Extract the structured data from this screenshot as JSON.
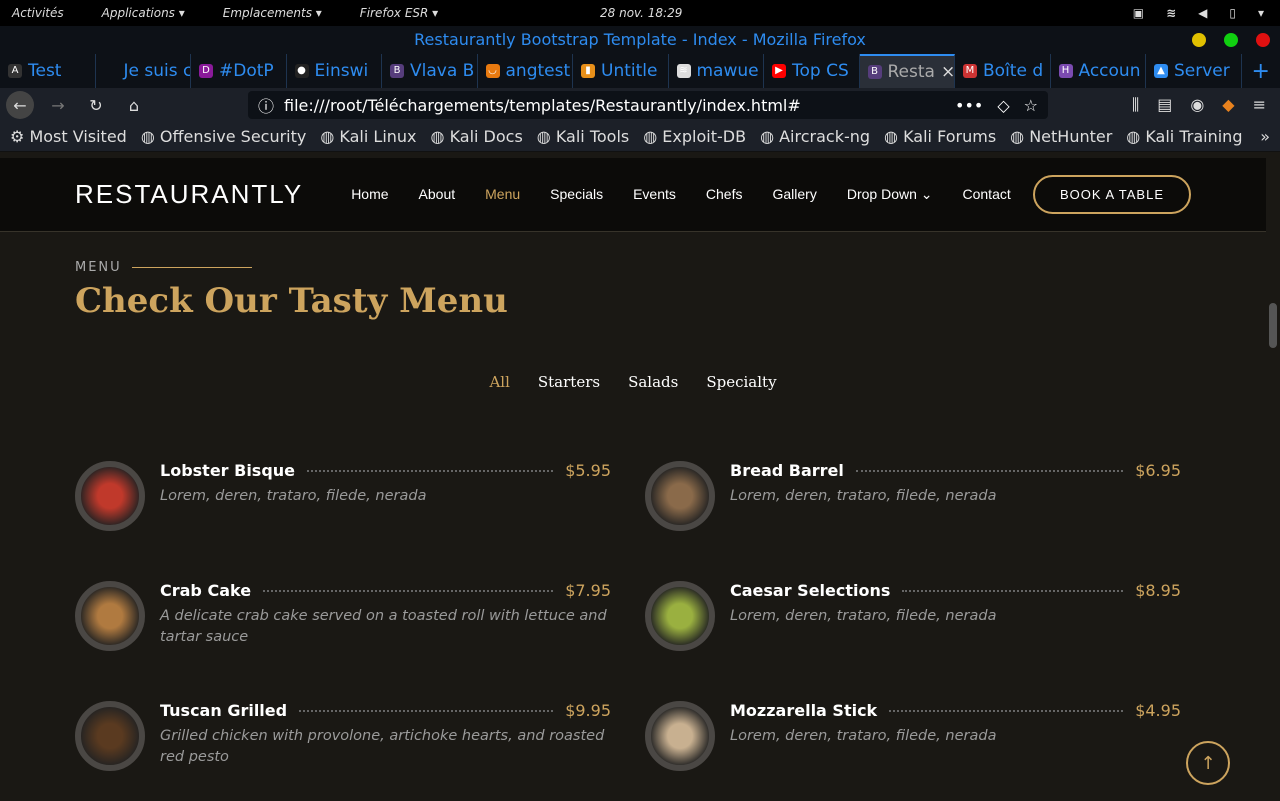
{
  "system": {
    "activities": "Activités",
    "applications": "Applications ▾",
    "places": "Emplacements ▾",
    "app": "Firefox ESR ▾",
    "clock": "28 nov. 18:29"
  },
  "window": {
    "title": "Restaurantly Bootstrap Template - Index - Mozilla Firefox"
  },
  "tabs": [
    {
      "label": "Test",
      "icon": "A",
      "color": "#333"
    },
    {
      "label": "Je suis ca",
      "icon": "",
      "color": "transparent"
    },
    {
      "label": "#DotP",
      "icon": "D",
      "color": "#8a1a9a"
    },
    {
      "label": "Einswi",
      "icon": "●",
      "color": "#222"
    },
    {
      "label": "Vlava B",
      "icon": "B",
      "color": "#563d7c"
    },
    {
      "label": "angtest",
      "icon": "◡",
      "color": "#e87a10"
    },
    {
      "label": "Untitle",
      "icon": "▮",
      "color": "#e8901a"
    },
    {
      "label": "mawue",
      "icon": "≋",
      "color": "#ddd"
    },
    {
      "label": "Top CS",
      "icon": "▶",
      "color": "#f00"
    },
    {
      "label": "Resta",
      "icon": "B",
      "color": "#563d7c"
    },
    {
      "label": "Boîte d",
      "icon": "M",
      "color": "#c33"
    },
    {
      "label": "Accoun",
      "icon": "H",
      "color": "#7b4bb0"
    },
    {
      "label": "Server",
      "icon": "▲",
      "color": "#2e8cf0"
    }
  ],
  "url": "file:///root/Téléchargements/templates/Restaurantly/index.html#",
  "bookmarks": [
    "Most Visited",
    "Offensive Security",
    "Kali Linux",
    "Kali Docs",
    "Kali Tools",
    "Exploit-DB",
    "Aircrack-ng",
    "Kali Forums",
    "NetHunter",
    "Kali Training"
  ],
  "site": {
    "logo": "RESTAURANTLY",
    "nav": [
      "Home",
      "About",
      "Menu",
      "Specials",
      "Events",
      "Chefs",
      "Gallery",
      "Drop Down ⌄",
      "Contact"
    ],
    "book": "BOOK A TABLE"
  },
  "section": {
    "label": "MENU",
    "title": "Check Our Tasty Menu",
    "filters": [
      "All",
      "Starters",
      "Salads",
      "Specialty"
    ]
  },
  "items": [
    {
      "name": "Lobster Bisque",
      "price": "$5.95",
      "desc": "Lorem, deren, trataro, filede, nerada",
      "color": "#c0392b"
    },
    {
      "name": "Bread Barrel",
      "price": "$6.95",
      "desc": "Lorem, deren, trataro, filede, nerada",
      "color": "#8a6a4a"
    },
    {
      "name": "Crab Cake",
      "price": "$7.95",
      "desc": "A delicate crab cake served on a toasted roll with lettuce and tartar sauce",
      "color": "#b07a40"
    },
    {
      "name": "Caesar Selections",
      "price": "$8.95",
      "desc": "Lorem, deren, trataro, filede, nerada",
      "color": "#9ab040"
    },
    {
      "name": "Tuscan Grilled",
      "price": "$9.95",
      "desc": "Grilled chicken with provolone, artichoke hearts, and roasted red pesto",
      "color": "#5a3a20"
    },
    {
      "name": "Mozzarella Stick",
      "price": "$4.95",
      "desc": "Lorem, deren, trataro, filede, nerada",
      "color": "#c8b090"
    }
  ]
}
